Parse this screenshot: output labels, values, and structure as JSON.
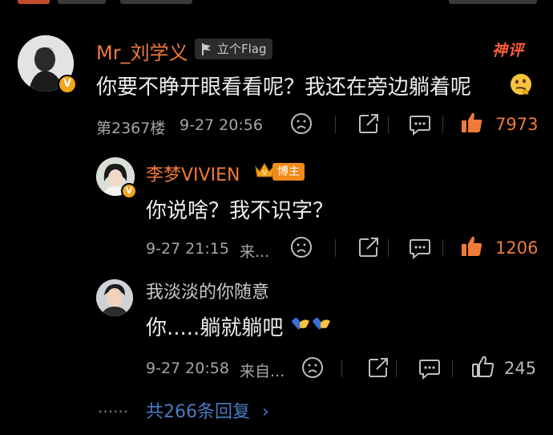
{
  "comment": {
    "username": "Mr_刘学义",
    "flag_tag": "立个Flag",
    "badge": "神评",
    "text": "你要不睁开眼看看呢？我还在旁边躺着呢",
    "floor": "第2367楼",
    "time": "9-27 20:56",
    "likes": "7973"
  },
  "replies": [
    {
      "username": "李梦VIVIEN",
      "role_tag": "博主",
      "text": "你说啥？我不识字？",
      "time": "9-27 21:15",
      "source": "来...",
      "likes": "1206"
    },
    {
      "username": "我淡淡的你随意",
      "text": "你.....躺就躺吧",
      "time": "9-27 20:58",
      "source": "来自...",
      "likes": "245"
    }
  ],
  "more": {
    "dots": "......",
    "label": "共266条回复",
    "arrow": "›"
  },
  "colors": {
    "accent": "#f07a3a",
    "link": "#4b7ac4",
    "verified": "#f3a51c",
    "background": "#000000"
  },
  "icons": [
    "flag-icon",
    "verified-v-icon",
    "crown-icon",
    "sad-face-icon",
    "share-icon",
    "comment-icon",
    "thumbs-up-icon",
    "thinking-emoji",
    "handshake-emoji"
  ]
}
